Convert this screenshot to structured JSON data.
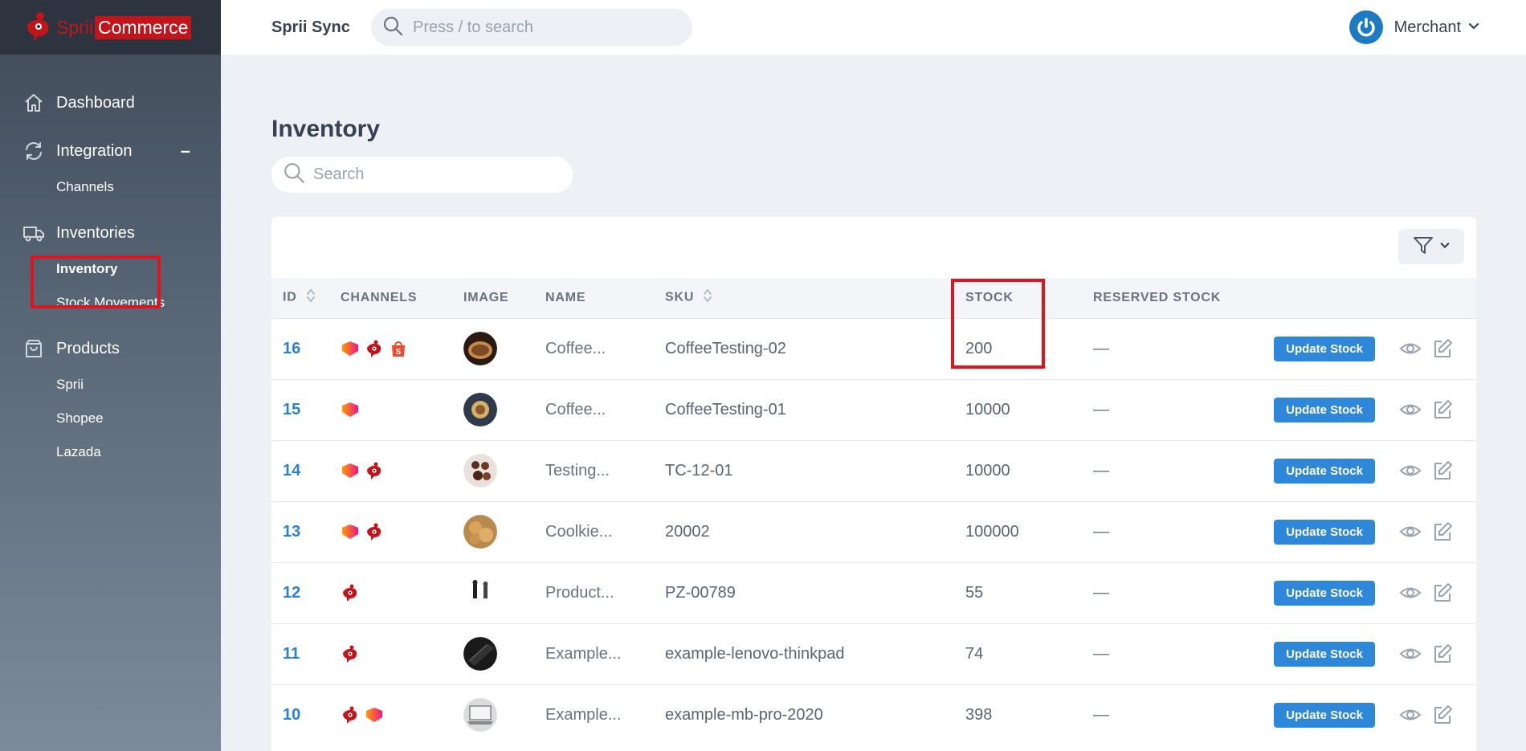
{
  "app": {
    "logo_part1": "Sprii",
    "logo_part2": "Commerce",
    "brand": "Sprii Sync"
  },
  "topbar": {
    "search_placeholder": "Press / to search",
    "user_name": "Merchant"
  },
  "sidebar": {
    "dashboard": "Dashboard",
    "integration": "Integration",
    "integration_toggle": "–",
    "channels": "Channels",
    "inventories": "Inventories",
    "inventory": "Inventory",
    "stock_movements": "Stock Movements",
    "products": "Products",
    "product_sprii": "Sprii",
    "product_shopee": "Shopee",
    "product_lazada": "Lazada"
  },
  "main": {
    "title": "Inventory",
    "search_placeholder": "Search"
  },
  "table": {
    "headers": {
      "id": "ID",
      "channels": "CHANNELS",
      "image": "IMAGE",
      "name": "NAME",
      "sku": "SKU",
      "stock": "STOCK",
      "reserved": "RESERVED STOCK"
    },
    "update_label": "Update Stock",
    "rows": [
      {
        "id": "16",
        "channels": [
          "lazada",
          "sprii",
          "shopee"
        ],
        "image": "coffee-cup",
        "name": "Coffee...",
        "sku": "CoffeeTesting-02",
        "stock": "200",
        "reserved": "—"
      },
      {
        "id": "15",
        "channels": [
          "lazada"
        ],
        "image": "coffee-top",
        "name": "Coffee...",
        "sku": "CoffeeTesting-01",
        "stock": "10000",
        "reserved": "—"
      },
      {
        "id": "14",
        "channels": [
          "lazada",
          "sprii"
        ],
        "image": "chocolate",
        "name": "Testing...",
        "sku": "TC-12-01",
        "stock": "10000",
        "reserved": "—"
      },
      {
        "id": "13",
        "channels": [
          "lazada",
          "sprii"
        ],
        "image": "cookies",
        "name": "Coolkie...",
        "sku": "20002",
        "stock": "100000",
        "reserved": "—"
      },
      {
        "id": "12",
        "channels": [
          "sprii"
        ],
        "image": "figures",
        "name": "Product...",
        "sku": "PZ-00789",
        "stock": "55",
        "reserved": "—"
      },
      {
        "id": "11",
        "channels": [
          "sprii"
        ],
        "image": "laptop-dark",
        "name": "Example...",
        "sku": "example-lenovo-thinkpad",
        "stock": "74",
        "reserved": "—"
      },
      {
        "id": "10",
        "channels": [
          "sprii",
          "lazada"
        ],
        "image": "laptop-light",
        "name": "Example...",
        "sku": "example-mb-pro-2020",
        "stock": "398",
        "reserved": "—"
      }
    ]
  },
  "colors": {
    "accent": "#2e87d8",
    "brand_red": "#c0161b",
    "highlight": "#e0141e",
    "lazada": "#f57224",
    "shopee": "#ee4d2d"
  }
}
